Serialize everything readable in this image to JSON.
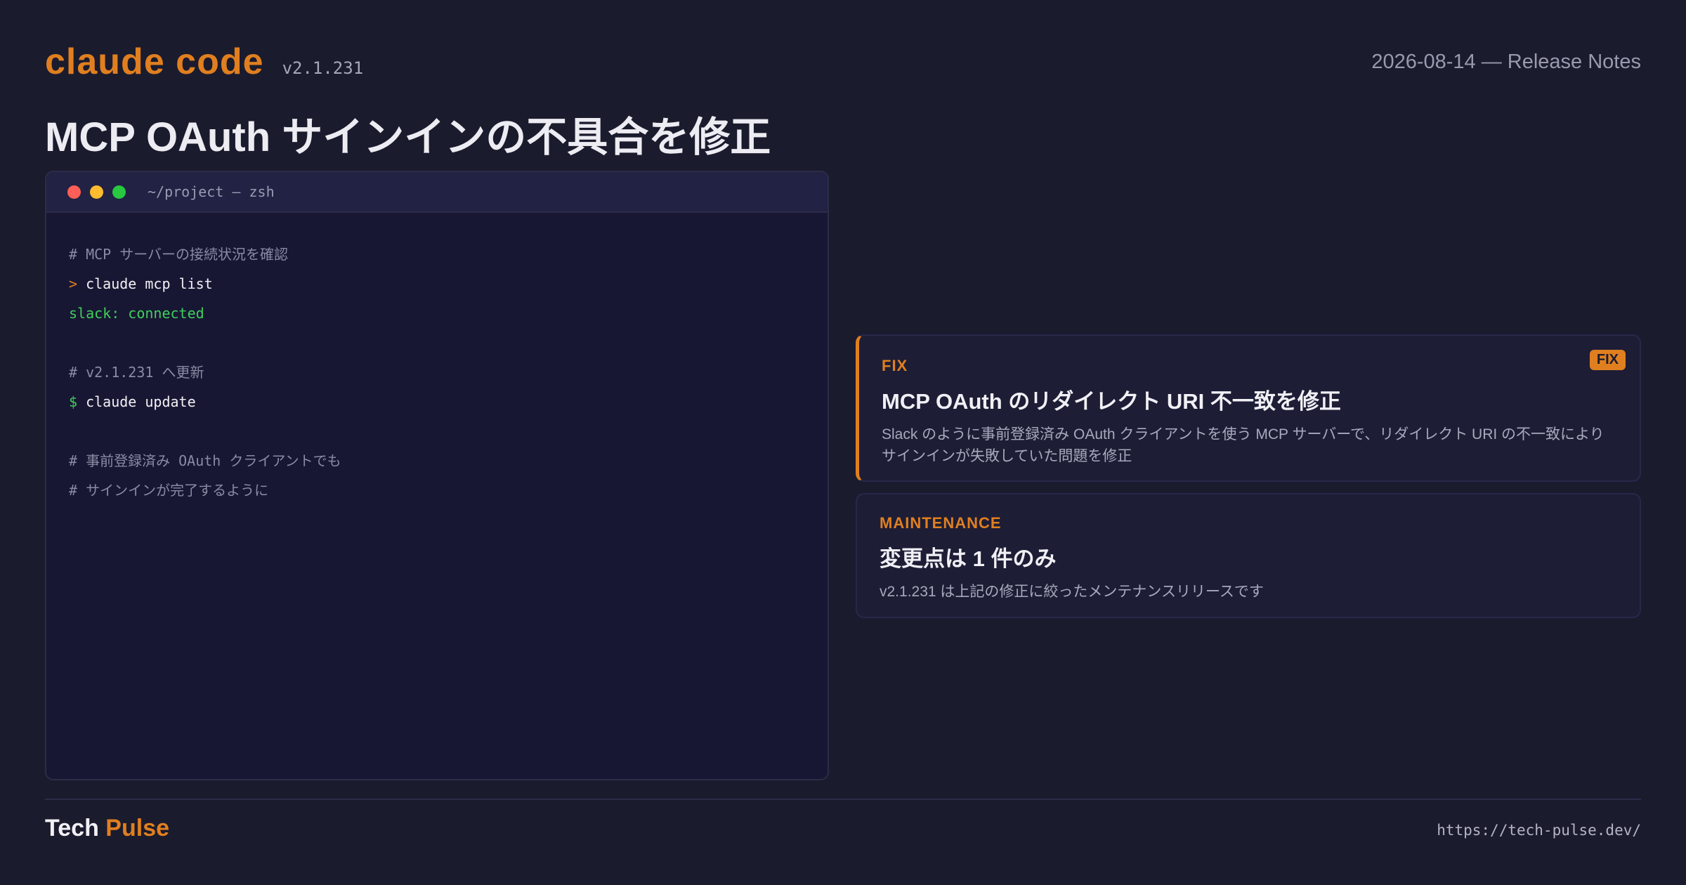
{
  "header": {
    "brand": "claude code",
    "version": "v2.1.231",
    "date_line": "2026-08-14 — Release Notes",
    "headline": "MCP OAuth サインインの不具合を修正"
  },
  "terminal": {
    "title": "~/project — zsh",
    "lines": {
      "l1": "# MCP サーバーの接続状況を確認",
      "l2_prompt": ">",
      "l2_cmd": " claude mcp list",
      "l3": "slack: connected",
      "l4": "# v2.1.231 へ更新",
      "l5_prompt": "$",
      "l5_cmd": " claude update",
      "l6": "# 事前登録済み OAuth クライアントでも",
      "l7": "# サインインが完了するように"
    }
  },
  "cards": {
    "fix": {
      "tag": "FIX",
      "badge": "FIX",
      "title": "MCP OAuth のリダイレクト URI 不一致を修正",
      "desc": "Slack のように事前登録済み OAuth クライアントを使う MCP サーバーで、リダイレクト URI の不一致によりサインインが失敗していた問題を修正"
    },
    "maintenance": {
      "tag": "MAINTENANCE",
      "title": "変更点は 1 件のみ",
      "desc": "v2.1.231 は上記の修正に絞ったメンテナンスリリースです"
    }
  },
  "footer": {
    "brand_part1": "Tech",
    "brand_part2": "Pulse",
    "url": "https://tech-pulse.dev/"
  },
  "colors": {
    "background": "#1b1b2e",
    "accent": "#e07f1f",
    "terminal_green": "#3fcf5b"
  }
}
